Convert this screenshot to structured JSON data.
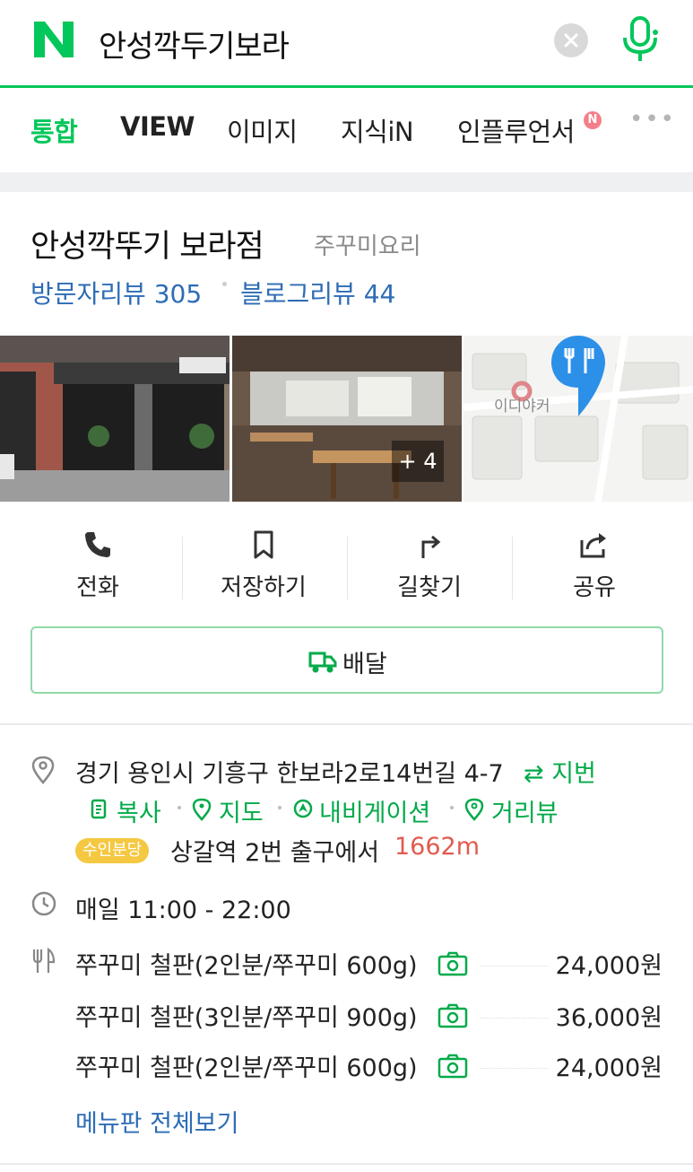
{
  "search": {
    "query": "안성깍두기보라",
    "logo_icon": "naver-logo-icon",
    "clear_icon": "clear-icon",
    "mic_icon": "mic-icon",
    "brand_color": "#03c75a"
  },
  "tabs": [
    {
      "label": "통합",
      "active": true
    },
    {
      "label": "VIEW",
      "active": false
    },
    {
      "label": "이미지",
      "active": false
    },
    {
      "label": "지식iN",
      "active": false
    },
    {
      "label": "인플루언서",
      "active": false,
      "badge": "N"
    }
  ],
  "place": {
    "name": "안성깍뚜기 보라점",
    "category": "주꾸미요리",
    "visitor_review": "방문자리뷰 305",
    "blog_review": "블로그리뷰 44",
    "photo_more": "+ 4",
    "map_label": "이디야커"
  },
  "actions": [
    {
      "label": "전화",
      "icon": "phone-icon"
    },
    {
      "label": "저장하기",
      "icon": "bookmark-icon"
    },
    {
      "label": "길찾기",
      "icon": "directions-icon"
    },
    {
      "label": "공유",
      "icon": "share-icon"
    }
  ],
  "delivery": {
    "label": "배달",
    "icon": "delivery-truck-icon"
  },
  "info": {
    "address": "경기 용인시 기흥구 한보라2로14번길 4-7",
    "jibun": "⇄ 지번",
    "copy": "복사",
    "map": "지도",
    "navigation": "내비게이션",
    "street_view": "거리뷰",
    "line_badge": "수인분당",
    "station": "상갈역 2번 출구에서",
    "distance": "1662m",
    "hours": "매일 11:00 - 22:00"
  },
  "menu": {
    "items": [
      {
        "name": "쭈꾸미 철판(2인분/쭈꾸미 600g)",
        "price": "24,000원"
      },
      {
        "name": "쭈꾸미 철판(3인분/쭈꾸미 900g)",
        "price": "36,000원"
      },
      {
        "name": "쭈꾸미 철판(2인분/쭈꾸미 600g)",
        "price": "24,000원"
      }
    ],
    "view_all": "메뉴판 전체보기"
  }
}
